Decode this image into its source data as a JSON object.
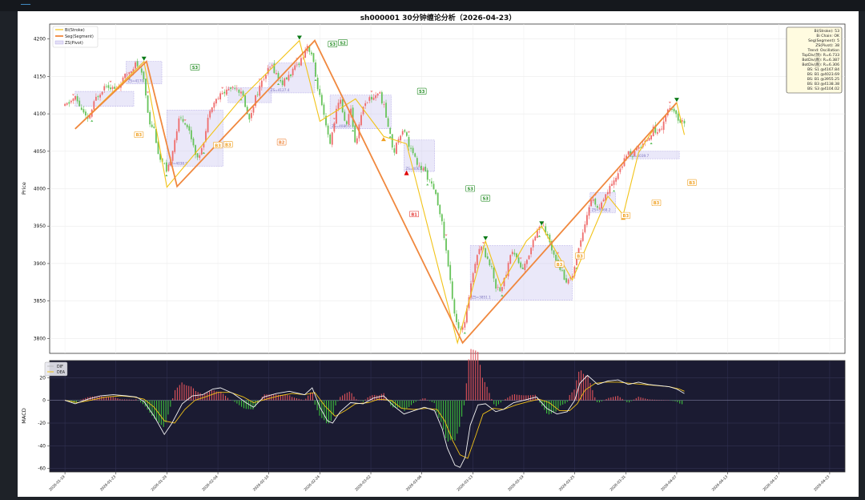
{
  "window": {
    "top_link": "━━━━"
  },
  "chart_data": {
    "type": "line",
    "title": "sh000001 30分钟缠论分析（2026-04-23）",
    "price_panel": {
      "ylabel": "Price",
      "ylim": [
        3780,
        4220
      ],
      "yticks": [
        3800,
        3850,
        3900,
        3950,
        4000,
        4050,
        4100,
        4150,
        4200
      ],
      "grid": true,
      "legend_position": "top-left",
      "legend": [
        {
          "label": "Bi(Stroke)",
          "color": "#f2c318"
        },
        {
          "label": "Seg(Segment)",
          "color": "#f0883e"
        },
        {
          "label": "ZS(Pivot)",
          "color": "#c9c2ee"
        }
      ],
      "candles_x": [
        0,
        150
      ],
      "price_path": [
        [
          0,
          4110
        ],
        [
          4,
          4122
        ],
        [
          9,
          4090
        ],
        [
          12,
          4120
        ],
        [
          16,
          4140
        ],
        [
          20,
          4132
        ],
        [
          24,
          4152
        ],
        [
          28,
          4168
        ],
        [
          31,
          4145
        ],
        [
          33,
          4090
        ],
        [
          35,
          4080
        ],
        [
          37,
          4040
        ],
        [
          39,
          4030
        ],
        [
          40,
          4018
        ],
        [
          42,
          4050
        ],
        [
          45,
          4095
        ],
        [
          47,
          4090
        ],
        [
          49,
          4075
        ],
        [
          51,
          4052
        ],
        [
          52,
          4038
        ],
        [
          55,
          4072
        ],
        [
          57,
          4110
        ],
        [
          61,
          4125
        ],
        [
          64,
          4133
        ],
        [
          67,
          4138
        ],
        [
          70,
          4122
        ],
        [
          71,
          4108
        ],
        [
          72,
          4090
        ],
        [
          75,
          4125
        ],
        [
          78,
          4148
        ],
        [
          81,
          4165
        ],
        [
          85,
          4140
        ],
        [
          89,
          4155
        ],
        [
          93,
          4175
        ],
        [
          95,
          4192
        ],
        [
          97,
          4178
        ],
        [
          98,
          4155
        ],
        [
          100,
          4122
        ],
        [
          102,
          4088
        ],
        [
          104,
          4058
        ],
        [
          106,
          4098
        ],
        [
          108,
          4122
        ],
        [
          110,
          4082
        ],
        [
          112,
          4108
        ],
        [
          114,
          4058
        ],
        [
          116,
          4098
        ],
        [
          118,
          4118
        ],
        [
          121,
          4122
        ],
        [
          123,
          4130
        ],
        [
          125,
          4112
        ],
        [
          127,
          4080
        ],
        [
          129,
          4048
        ],
        [
          131,
          4070
        ],
        [
          133,
          4082
        ],
        [
          135,
          4058
        ],
        [
          137,
          4042
        ],
        [
          139,
          4028
        ],
        [
          141,
          4025
        ],
        [
          143,
          4010
        ],
        [
          145,
          3995
        ],
        [
          147,
          3972
        ],
        [
          149,
          3930
        ],
        [
          151,
          3880
        ],
        [
          153,
          3830
        ],
        [
          155,
          3808
        ],
        [
          157,
          3820
        ],
        [
          159,
          3870
        ],
        [
          161,
          3905
        ],
        [
          163,
          3925
        ],
        [
          165,
          3912
        ],
        [
          167,
          3898
        ],
        [
          169,
          3870
        ],
        [
          171,
          3865
        ],
        [
          173,
          3885
        ],
        [
          175,
          3918
        ],
        [
          177,
          3910
        ],
        [
          179,
          3892
        ],
        [
          181,
          3900
        ],
        [
          183,
          3925
        ],
        [
          185,
          3945
        ],
        [
          187,
          3952
        ],
        [
          189,
          3938
        ],
        [
          191,
          3920
        ],
        [
          193,
          3905
        ],
        [
          195,
          3888
        ],
        [
          197,
          3875
        ],
        [
          199,
          3885
        ],
        [
          201,
          3912
        ],
        [
          203,
          3942
        ],
        [
          205,
          3968
        ],
        [
          207,
          3990
        ],
        [
          209,
          3972
        ],
        [
          211,
          3980
        ],
        [
          213,
          3998
        ],
        [
          215,
          4005
        ],
        [
          217,
          4022
        ],
        [
          219,
          4035
        ],
        [
          221,
          4048
        ],
        [
          223,
          4045
        ],
        [
          225,
          4055
        ],
        [
          227,
          4060
        ],
        [
          229,
          4070
        ],
        [
          231,
          4080
        ],
        [
          233,
          4075
        ],
        [
          235,
          4092
        ],
        [
          237,
          4108
        ],
        [
          239,
          4100
        ],
        [
          241,
          4092
        ],
        [
          243,
          4088
        ]
      ],
      "bi_points": [
        [
          4,
          4080
        ],
        [
          31,
          4170
        ],
        [
          40,
          4002
        ],
        [
          69,
          4120
        ],
        [
          92,
          4198
        ],
        [
          100,
          4090
        ],
        [
          114,
          4120
        ],
        [
          125,
          4070
        ],
        [
          134,
          4060
        ],
        [
          154,
          3794
        ],
        [
          165,
          3930
        ],
        [
          171,
          3870
        ],
        [
          181,
          3930
        ],
        [
          187,
          3950
        ],
        [
          199,
          3878
        ],
        [
          213,
          3990
        ],
        [
          219,
          3965
        ],
        [
          225,
          4048
        ],
        [
          231,
          4080
        ],
        [
          240,
          4115
        ],
        [
          243,
          4072
        ]
      ],
      "seg_points": [
        [
          4,
          4080
        ],
        [
          32,
          4170
        ],
        [
          44,
          4003
        ],
        [
          98,
          4198
        ],
        [
          156,
          3794
        ],
        [
          240,
          4115
        ]
      ],
      "pivots": [
        {
          "x": [
            4,
            27
          ],
          "y": [
            4110,
            4130
          ],
          "label": ""
        },
        {
          "x": [
            24,
            38
          ],
          "y": [
            4140,
            4170
          ],
          "label": "ZS=4170.1"
        },
        {
          "x": [
            40,
            62
          ],
          "y": [
            4030,
            4105
          ],
          "label": "ZS=4038.9"
        },
        {
          "x": [
            64,
            81
          ],
          "y": [
            4115,
            4135
          ],
          "label": ""
        },
        {
          "x": [
            80,
            98
          ],
          "y": [
            4128,
            4168
          ],
          "label": "ZS=4127.4"
        },
        {
          "x": [
            104,
            128
          ],
          "y": [
            4080,
            4125
          ],
          "label": "ZS=4080.0"
        },
        {
          "x": [
            133,
            145
          ],
          "y": [
            4023,
            4065
          ],
          "label": "ZS=4065.3"
        },
        {
          "x": [
            159,
            199
          ],
          "y": [
            3851,
            3924
          ],
          "label": "ZS=3851.1"
        },
        {
          "x": [
            206,
            216
          ],
          "y": [
            3968,
            3995
          ],
          "label": "ZS=3968.2"
        },
        {
          "x": [
            221,
            241
          ],
          "y": [
            4040,
            4050
          ],
          "label": "ZS=4039.7"
        }
      ],
      "signals": [
        {
          "label": "S3",
          "x": 51,
          "y": 4162,
          "color": "#228b22"
        },
        {
          "label": "S3",
          "x": 105,
          "y": 4193,
          "color": "#228b22"
        },
        {
          "label": "S2",
          "x": 109,
          "y": 4195,
          "color": "#228b22"
        },
        {
          "label": "S3",
          "x": 140,
          "y": 4130,
          "color": "#228b22"
        },
        {
          "label": "S3",
          "x": 159,
          "y": 4000,
          "color": "#228b22"
        },
        {
          "label": "S3",
          "x": 165,
          "y": 3987,
          "color": "#228b22"
        },
        {
          "label": "B3",
          "x": 29,
          "y": 4072,
          "color": "#f0a020"
        },
        {
          "label": "B3",
          "x": 60,
          "y": 4058,
          "color": "#f0a020"
        },
        {
          "label": "B3",
          "x": 64,
          "y": 4059,
          "color": "#f0a020"
        },
        {
          "label": "B2",
          "x": 85,
          "y": 4062,
          "color": "#f0883e"
        },
        {
          "label": "B1",
          "x": 137,
          "y": 3966,
          "color": "#e53935"
        },
        {
          "label": "B3",
          "x": 194,
          "y": 3899,
          "color": "#f0a020"
        },
        {
          "label": "B3",
          "x": 202,
          "y": 3910,
          "color": "#f0a020"
        },
        {
          "label": "B3",
          "x": 220,
          "y": 3964,
          "color": "#f0a020"
        },
        {
          "label": "B3",
          "x": 232,
          "y": 3981,
          "color": "#f0a020"
        },
        {
          "label": "B3",
          "x": 246,
          "y": 4008,
          "color": "#f0a020"
        }
      ],
      "info_box": [
        "Bi(Stroke): 53",
        "Bi Chain: OK",
        "Seg(Segment): 5",
        "ZS(Pivot): 38",
        "Trend: Oscillation",
        "TopDiv(顶): R=6.733",
        "BotDiv(底): R=6.387",
        "BotDiv(底): R=6.306",
        "BS: S1 @4167.84",
        "BS: B1 @4023.69",
        "BS: B1 @3955.25",
        "BS: B3 @4138.38",
        "BS: S3 @4104.02"
      ]
    },
    "macd_panel": {
      "ylabel": "MACD",
      "ylim": [
        -63,
        35
      ],
      "yticks": [
        -60,
        -40,
        -20,
        0,
        20
      ],
      "legend": [
        {
          "label": "DIF",
          "color": "#f3f3f3"
        },
        {
          "label": "DEA",
          "color": "#f2c318"
        }
      ],
      "background": "#1b1b32",
      "dif": [
        [
          0,
          0
        ],
        [
          4,
          -3
        ],
        [
          9,
          1
        ],
        [
          14,
          4
        ],
        [
          19,
          5
        ],
        [
          24,
          4
        ],
        [
          28,
          3
        ],
        [
          31,
          -1
        ],
        [
          35,
          -14
        ],
        [
          39,
          -30
        ],
        [
          42,
          -20
        ],
        [
          46,
          -3
        ],
        [
          50,
          4
        ],
        [
          54,
          5
        ],
        [
          58,
          10
        ],
        [
          61,
          11
        ],
        [
          66,
          6
        ],
        [
          71,
          -2
        ],
        [
          74,
          -6
        ],
        [
          78,
          3
        ],
        [
          83,
          6
        ],
        [
          88,
          8
        ],
        [
          94,
          5
        ],
        [
          97,
          11
        ],
        [
          100,
          -6
        ],
        [
          103,
          -18
        ],
        [
          105,
          -20
        ],
        [
          108,
          -10
        ],
        [
          112,
          -2
        ],
        [
          117,
          -3
        ],
        [
          121,
          2
        ],
        [
          125,
          4
        ],
        [
          129,
          -5
        ],
        [
          133,
          -12
        ],
        [
          137,
          -9
        ],
        [
          141,
          -6
        ],
        [
          145,
          -9
        ],
        [
          148,
          -25
        ],
        [
          150,
          -42
        ],
        [
          153,
          -57
        ],
        [
          155,
          -59
        ],
        [
          157,
          -50
        ],
        [
          159,
          -22
        ],
        [
          162,
          -4
        ],
        [
          165,
          -3
        ],
        [
          169,
          -10
        ],
        [
          172,
          -8
        ],
        [
          176,
          -2
        ],
        [
          180,
          0
        ],
        [
          185,
          3
        ],
        [
          189,
          -7
        ],
        [
          193,
          -12
        ],
        [
          197,
          -10
        ],
        [
          200,
          0
        ],
        [
          202,
          15
        ],
        [
          205,
          22
        ],
        [
          209,
          14
        ],
        [
          213,
          17
        ],
        [
          217,
          18
        ],
        [
          221,
          14
        ],
        [
          225,
          16
        ],
        [
          229,
          14
        ],
        [
          233,
          13
        ],
        [
          237,
          12
        ],
        [
          240,
          10
        ],
        [
          243,
          6
        ]
      ],
      "dea": [
        [
          0,
          0
        ],
        [
          5,
          -2
        ],
        [
          10,
          0
        ],
        [
          16,
          3
        ],
        [
          22,
          4
        ],
        [
          27,
          3
        ],
        [
          31,
          1
        ],
        [
          35,
          -6
        ],
        [
          39,
          -18
        ],
        [
          43,
          -20
        ],
        [
          47,
          -8
        ],
        [
          51,
          0
        ],
        [
          55,
          3
        ],
        [
          60,
          7
        ],
        [
          65,
          7
        ],
        [
          70,
          3
        ],
        [
          74,
          -2
        ],
        [
          79,
          1
        ],
        [
          84,
          4
        ],
        [
          89,
          6
        ],
        [
          94,
          5
        ],
        [
          98,
          7
        ],
        [
          102,
          -5
        ],
        [
          106,
          -14
        ],
        [
          110,
          -9
        ],
        [
          114,
          -3
        ],
        [
          119,
          -2
        ],
        [
          123,
          1
        ],
        [
          128,
          0
        ],
        [
          132,
          -7
        ],
        [
          137,
          -8
        ],
        [
          142,
          -7
        ],
        [
          146,
          -8
        ],
        [
          149,
          -18
        ],
        [
          152,
          -35
        ],
        [
          155,
          -48
        ],
        [
          158,
          -51
        ],
        [
          161,
          -32
        ],
        [
          164,
          -12
        ],
        [
          168,
          -7
        ],
        [
          172,
          -8
        ],
        [
          177,
          -4
        ],
        [
          182,
          -1
        ],
        [
          186,
          1
        ],
        [
          190,
          -2
        ],
        [
          194,
          -9
        ],
        [
          198,
          -9
        ],
        [
          201,
          -3
        ],
        [
          204,
          9
        ],
        [
          208,
          15
        ],
        [
          212,
          16
        ],
        [
          217,
          16
        ],
        [
          222,
          15
        ],
        [
          227,
          14
        ],
        [
          232,
          13
        ],
        [
          237,
          12
        ],
        [
          241,
          10
        ],
        [
          243,
          8
        ]
      ]
    },
    "x_ticks": [
      {
        "x": 0,
        "label": "2026-01-19"
      },
      {
        "x": 20,
        "label": "2026-01-23"
      },
      {
        "x": 40,
        "label": "2026-01-29"
      },
      {
        "x": 60,
        "label": "2026-02-04"
      },
      {
        "x": 80,
        "label": "2026-02-10"
      },
      {
        "x": 100,
        "label": "2026-02-24"
      },
      {
        "x": 120,
        "label": "2026-03-02"
      },
      {
        "x": 140,
        "label": "2026-03-06"
      },
      {
        "x": 160,
        "label": "2026-03-13"
      },
      {
        "x": 180,
        "label": "2026-03-19"
      },
      {
        "x": 200,
        "label": "2026-03-25"
      },
      {
        "x": 220,
        "label": "2026-03-31"
      },
      {
        "x": 240,
        "label": "2026-04-07"
      },
      {
        "x": 260,
        "label": "2026-04-13"
      },
      {
        "x": 280,
        "label": "2026-04-17"
      },
      {
        "x": 300,
        "label": "2026-04-23"
      }
    ],
    "x_range": [
      -6,
      306
    ]
  }
}
